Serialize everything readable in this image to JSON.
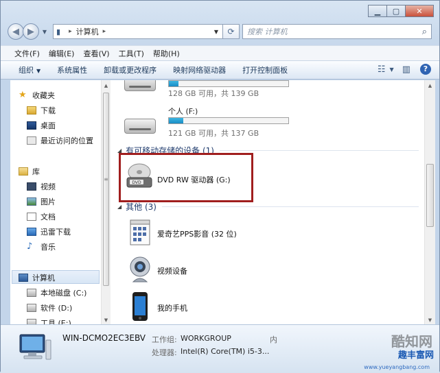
{
  "window": {
    "title_controls": [
      "minimize",
      "maximize",
      "close"
    ]
  },
  "nav": {
    "address": {
      "root_label": "计算机"
    },
    "search": {
      "placeholder": "搜索 计算机"
    }
  },
  "menu": [
    "文件(F)",
    "编辑(E)",
    "查看(V)",
    "工具(T)",
    "帮助(H)"
  ],
  "toolbar": {
    "items": [
      "组织",
      "系统属性",
      "卸载或更改程序",
      "映射网络驱动器",
      "打开控制面板"
    ]
  },
  "sidebar": {
    "favorites": {
      "label": "收藏夹",
      "items": [
        "下载",
        "桌面",
        "最近访问的位置"
      ]
    },
    "library": {
      "label": "库",
      "items": [
        "视频",
        "图片",
        "文档",
        "迅雷下载",
        "音乐"
      ]
    },
    "computer": {
      "label": "计算机",
      "items": [
        "本地磁盘 (C:)",
        "软件 (D:)",
        "工具 (E:)"
      ]
    }
  },
  "drives": [
    {
      "name": "",
      "info": "128 GB 可用，共 139 GB",
      "used_fraction": 0.08
    },
    {
      "name": "个人 (F:)",
      "info": "121 GB 可用，共 137 GB",
      "used_fraction": 0.12
    }
  ],
  "groups": {
    "removable": "有可移动存储的设备 (1)",
    "other": "其他 (3)"
  },
  "removable_items": [
    {
      "label": "DVD RW 驱动器 (G:)",
      "icon": "dvd-drive-icon"
    }
  ],
  "other_items": [
    {
      "label": "爱奇艺PPS影音 (32 位)",
      "icon": "app-icon"
    },
    {
      "label": "视频设备",
      "icon": "webcam-icon"
    },
    {
      "label": "我的手机",
      "icon": "phone-icon"
    }
  ],
  "status": {
    "computer_name": "WIN-DCMO2EC3EBV",
    "workgroup_label": "工作组:",
    "workgroup_value": "WORKGROUP",
    "memory_label": "内",
    "processor_label": "处理器:",
    "processor_value": "Intel(R) Core(TM) i5-3..."
  },
  "watermark": {
    "brand": "酷知网",
    "site": "趣丰富网",
    "url": "www.yueyangbang.com"
  },
  "colors": {
    "highlight": "#a01e1e",
    "bar_fill": "#1a8cc4"
  }
}
